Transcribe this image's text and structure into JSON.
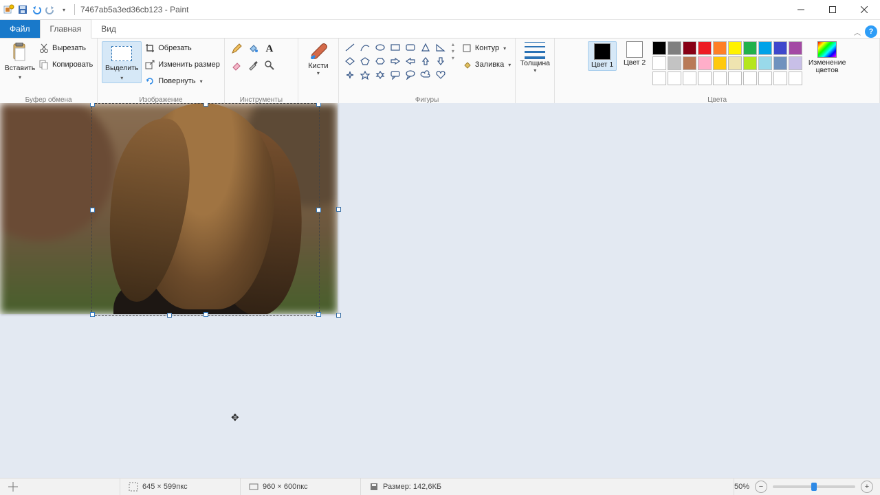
{
  "title": "7467ab5a3ed36cb123 - Paint",
  "tabs": {
    "file": "Файл",
    "home": "Главная",
    "view": "Вид"
  },
  "clipboard": {
    "paste": "Вставить",
    "cut": "Вырезать",
    "copy": "Копировать",
    "group": "Буфер обмена"
  },
  "image": {
    "select": "Выделить",
    "crop": "Обрезать",
    "resize": "Изменить размер",
    "rotate": "Повернуть",
    "group": "Изображение"
  },
  "tools": {
    "group": "Инструменты"
  },
  "brushes": {
    "label": "Кисти"
  },
  "shapes": {
    "outline": "Контур",
    "fill": "Заливка",
    "group": "Фигуры"
  },
  "thickness": {
    "label": "Толщина"
  },
  "colors": {
    "c1": "Цвет 1",
    "c2": "Цвет 2",
    "edit": "Изменение цветов",
    "group": "Цвета",
    "color1": "#000000",
    "color2": "#ffffff",
    "row1": [
      "#000000",
      "#7f7f7f",
      "#880015",
      "#ed1c24",
      "#ff7f27",
      "#fff200",
      "#22b14c",
      "#00a2e8",
      "#3f48cc",
      "#a349a4"
    ],
    "row2": [
      "#ffffff",
      "#c3c3c3",
      "#b97a57",
      "#ffaec9",
      "#ffc90e",
      "#efe4b0",
      "#b5e61d",
      "#99d9ea",
      "#7092be",
      "#c8bfe7"
    ],
    "row3": [
      "#ffffff",
      "#ffffff",
      "#ffffff",
      "#ffffff",
      "#ffffff",
      "#ffffff",
      "#ffffff",
      "#ffffff",
      "#ffffff",
      "#ffffff"
    ]
  },
  "status": {
    "pos": "",
    "sel": "645 × 599пкс",
    "dim": "960 × 600пкс",
    "size": "Размер: 142,6КБ",
    "zoom": "50%"
  }
}
